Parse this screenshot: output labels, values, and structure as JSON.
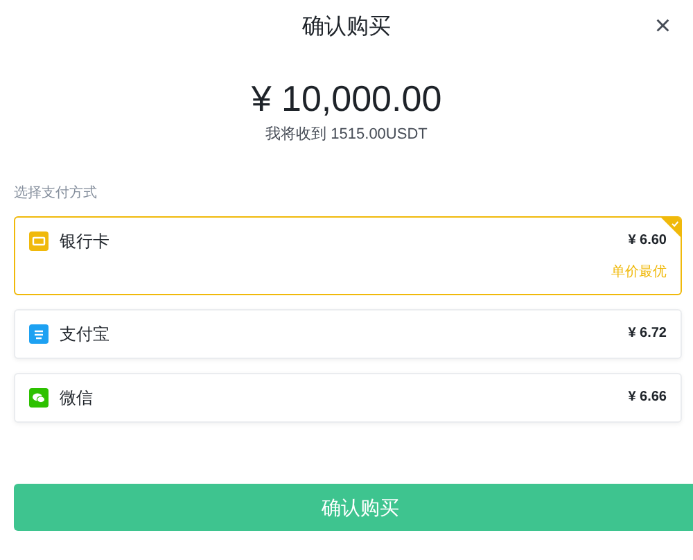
{
  "dialog": {
    "title": "确认购买",
    "close": "×"
  },
  "amount": "¥ 10,000.00",
  "receive": "我将收到 1515.00USDT",
  "methods_label": "选择支付方式",
  "methods": [
    {
      "kind": "bank",
      "name": "银行卡",
      "price": "¥ 6.60",
      "tag": "单价最优",
      "selected": true
    },
    {
      "kind": "alipay",
      "name": "支付宝",
      "price": "¥ 6.72",
      "selected": false
    },
    {
      "kind": "wechat",
      "name": "微信",
      "price": "¥ 6.66",
      "selected": false
    }
  ],
  "confirm": "确认购买"
}
